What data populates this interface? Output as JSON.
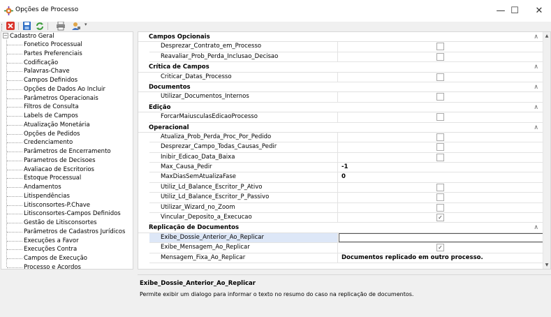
{
  "window": {
    "title": "Opções de Processo",
    "minimize": "—",
    "maximize": "☐",
    "close": "✕"
  },
  "toolbar": {
    "dropdown_glyph": "▾"
  },
  "tree": {
    "root_toggle": "−",
    "root": "Cadastro Geral",
    "items": [
      "Fonetico Processual",
      "Partes Preferenciais",
      "Codificação",
      "Palavras-Chave",
      "Campos Definidos",
      "Opções de Dados Ao Incluir",
      "Parâmetros Operacionais",
      "Filtros de Consulta",
      "Labels de Campos",
      "Atualização Monetária",
      "Opções de Pedidos",
      "Credenciamento",
      "Parâmetros de Encerramento",
      "Parametros de Decisoes",
      "Avaliacao de Escritorios",
      "Estoque Processual",
      "Andamentos",
      "Litispendências",
      "Litisconsortes-P.Chave",
      "Litisconsortes-Campos Definidos",
      "Gestão de Litisconsortes",
      "Parâmetros de Cadastros Jurídicos",
      "Execuções a Favor",
      "Execuções Contra",
      "Campos de Execução",
      "Processo e Acordos"
    ]
  },
  "grid": {
    "collapse_glyph": "∧",
    "check_glyph": "✓",
    "scroll_up": "▲",
    "scroll_down": "▼",
    "categories": [
      {
        "label": "Campos Opcionais",
        "props": [
          {
            "name": "Desprezar_Contrato_em_Processo",
            "type": "check",
            "checked": false
          },
          {
            "name": "Reavaliar_Prob_Perda_Inclusao_Decisao",
            "type": "check",
            "checked": false
          }
        ]
      },
      {
        "label": "Crítica de Campos",
        "props": [
          {
            "name": "Criticar_Datas_Processo",
            "type": "check",
            "checked": false
          }
        ]
      },
      {
        "label": "Documentos",
        "props": [
          {
            "name": "Utilizar_Documentos_Internos",
            "type": "check",
            "checked": false
          }
        ]
      },
      {
        "label": "Edição",
        "props": [
          {
            "name": "ForcarMaiusculasEdicaoProcesso",
            "type": "check",
            "checked": false
          }
        ]
      },
      {
        "label": "Operacional",
        "props": [
          {
            "name": "Atualiza_Prob_Perda_Proc_Por_Pedido",
            "type": "check",
            "checked": false
          },
          {
            "name": "Desprezar_Campo_Todas_Causas_Pedir",
            "type": "check",
            "checked": false
          },
          {
            "name": "Inibir_Edicao_Data_Baixa",
            "type": "check",
            "checked": false
          },
          {
            "name": "Max_Causa_Pedir",
            "type": "text",
            "value": "-1"
          },
          {
            "name": "MaxDiasSemAtualizaFase",
            "type": "text",
            "value": "0"
          },
          {
            "name": "Utiliz_Ld_Balance_Escritor_P_Ativo",
            "type": "check",
            "checked": false
          },
          {
            "name": "Utiliz_Ld_Balance_Escritor_P_Passivo",
            "type": "check",
            "checked": false
          },
          {
            "name": "Utilizar_Wizard_no_Zoom",
            "type": "check",
            "checked": false
          },
          {
            "name": "Vincular_Deposito_a_Execucao",
            "type": "check",
            "checked": true
          }
        ]
      },
      {
        "label": "Replicação de Documentos",
        "props": [
          {
            "name": "Exibe_Dossie_Anterior_Ao_Replicar",
            "type": "text",
            "value": "",
            "selected": true
          },
          {
            "name": "Exibe_Mensagem_Ao_Replicar",
            "type": "check",
            "checked": true
          },
          {
            "name": "Mensagem_Fixa_Ao_Replicar",
            "type": "text",
            "value": "Documentos replicado em outro processo."
          }
        ]
      }
    ]
  },
  "description": {
    "title": "Exibe_Dossie_Anterior_Ao_Replicar",
    "text": "Permite exibir um dialogo para informar o texto no resumo do caso na replicação de documentos."
  },
  "colors": {
    "accent_selection": "#dde7f7",
    "close_red": "#d9342b",
    "save_blue": "#2b6cc4",
    "refresh_green": "#3a9b3a"
  }
}
